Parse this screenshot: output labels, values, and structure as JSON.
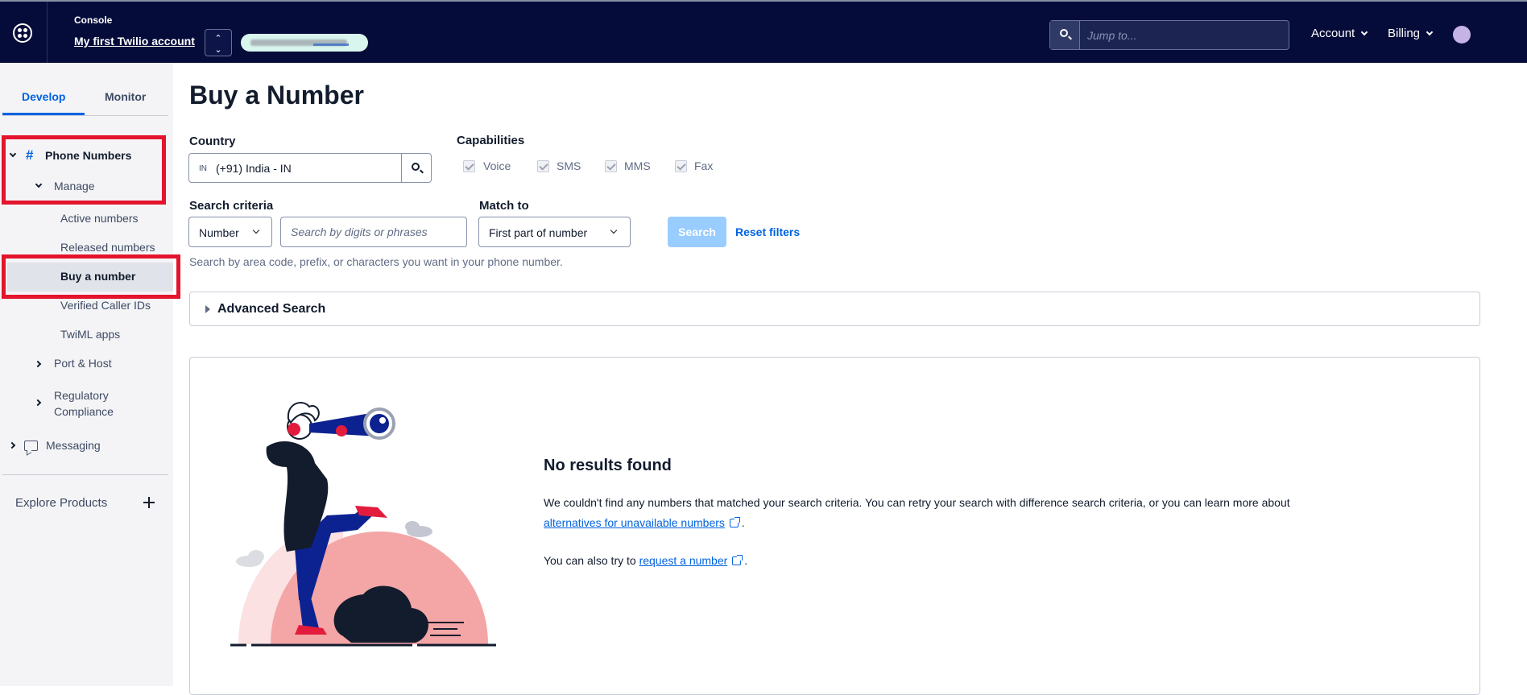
{
  "topbar": {
    "console_label": "Console",
    "account_name": "My first Twilio account",
    "jump_placeholder": "Jump to...",
    "account_menu": "Account",
    "billing_menu": "Billing"
  },
  "sidebar": {
    "tabs": {
      "develop": "Develop",
      "monitor": "Monitor"
    },
    "phone_numbers": "Phone Numbers",
    "manage": "Manage",
    "active_numbers": "Active numbers",
    "released_numbers": "Released numbers",
    "buy_a_number": "Buy a number",
    "verified_caller_ids": "Verified Caller IDs",
    "twiml_apps": "TwiML apps",
    "port_host": "Port & Host",
    "regulatory_line1": "Regulatory",
    "regulatory_line2": "Compliance",
    "messaging": "Messaging",
    "explore_products": "Explore Products"
  },
  "main": {
    "title": "Buy a Number",
    "country_label": "Country",
    "country_code": "IN",
    "country_value": "(+91) India - IN",
    "capabilities_label": "Capabilities",
    "capabilities": [
      "Voice",
      "SMS",
      "MMS",
      "Fax"
    ],
    "search_criteria_label": "Search criteria",
    "search_criteria_value": "Number",
    "search_input_placeholder": "Search by digits or phrases",
    "match_to_label": "Match to",
    "match_to_value": "First part of number",
    "search_button": "Search",
    "reset_filters": "Reset filters",
    "help_text": "Search by area code, prefix, or characters you want in your phone number.",
    "advanced_search": "Advanced Search",
    "no_results_title": "No results found",
    "no_results_text": "We couldn't find any numbers that matched your search criteria. You can retry your search with difference search criteria, or you can learn more about",
    "alternatives_link": "alternatives for unavailable numbers",
    "request_text": "You can also try to",
    "request_link": "request a number",
    "period": "."
  },
  "colors": {
    "topbar_bg": "#060c3a",
    "accent_blue": "#0263e0",
    "highlight_red": "#e3142c",
    "search_button_disabled": "#99cdff"
  }
}
